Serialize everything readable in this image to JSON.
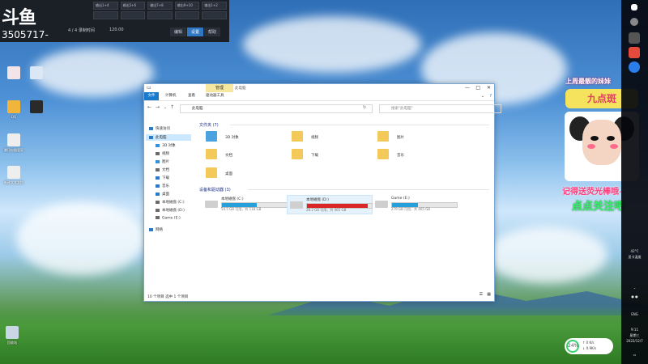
{
  "overlay": {
    "logo": "斗鱼",
    "room_id": "3505717-",
    "mixer": [
      [
        "输出1+4",
        "输出5+6",
        "输出7+8",
        "输出9+10",
        "输出1+2"
      ],
      [
        "",
        "",
        "",
        "",
        ""
      ]
    ],
    "status": "4 / 4  录制时间",
    "bpm": "120.00",
    "tabs": [
      "编辑",
      "设置",
      "帮助"
    ],
    "active_tab": 1
  },
  "desktop": {
    "icons": [
      "",
      "",
      "",
      "",
      "QQ",
      "",
      "腾讯电脑管家",
      "",
      "",
      "新建文本文档",
      "",
      "回收站"
    ]
  },
  "explorer": {
    "context_tab": "管理",
    "title": "此电脑",
    "ribbon_tabs": [
      "文件",
      "计算机",
      "查看",
      "驱动器工具"
    ],
    "breadcrumb": "此电脑",
    "search_placeholder": "搜索\"此电脑\"",
    "nav": [
      {
        "label": "快速访问",
        "color": "#2f78c4"
      },
      {
        "label": "此电脑",
        "color": "#2f78c4"
      },
      {
        "label": "3D 对象",
        "color": "#3b8fd4"
      },
      {
        "label": "视频",
        "color": "#6b6b6b"
      },
      {
        "label": "图片",
        "color": "#3b8fd4"
      },
      {
        "label": "文档",
        "color": "#6b6b6b"
      },
      {
        "label": "下载",
        "color": "#2f78c4"
      },
      {
        "label": "音乐",
        "color": "#2f78c4"
      },
      {
        "label": "桌面",
        "color": "#2f78c4"
      },
      {
        "label": "本地磁盘 (C:)",
        "color": "#6b6b6b"
      },
      {
        "label": "本地磁盘 (D:)",
        "color": "#6b6b6b"
      },
      {
        "label": "Game (E:)",
        "color": "#6b6b6b"
      },
      {
        "label": "网络",
        "color": "#2f78c4"
      }
    ],
    "folders_header": "文件夹 (7)",
    "folders": [
      "3D 对象",
      "视频",
      "图片",
      "文档",
      "下载",
      "音乐",
      "桌面"
    ],
    "drives_header": "设备和驱动器 (3)",
    "drives": [
      {
        "name": "本地磁盘 (C:)",
        "space": "54.5 GB 可用，共 118 GB",
        "used": 0.54,
        "color": "#26a0da",
        "selected": false
      },
      {
        "name": "本地磁盘 (D:)",
        "space": "28.2 GB 可用，共 465 GB",
        "used": 0.94,
        "color": "#da2626",
        "selected": true
      },
      {
        "name": "Game (E:)",
        "space": "279 GB 可用，共 465 GB",
        "used": 0.4,
        "color": "#26a0da",
        "selected": false
      }
    ],
    "status": "10 个项目    选中 1 个项目"
  },
  "stream_overlay": {
    "line1": "上周最靓的妹妹",
    "line2": "九点斑",
    "line3": "记得送荧光棒哦~",
    "line4": "点点关注吧"
  },
  "taskbar": {
    "temp": "42°C",
    "temp_label": "显卡温度",
    "lang": "ENG",
    "time": "9:11",
    "weekday": "星期三",
    "date": "2022/12/7"
  },
  "widget": {
    "percent": "24%",
    "up": "↑ 0 K/s",
    "down": "↓ 0.9K/s"
  }
}
